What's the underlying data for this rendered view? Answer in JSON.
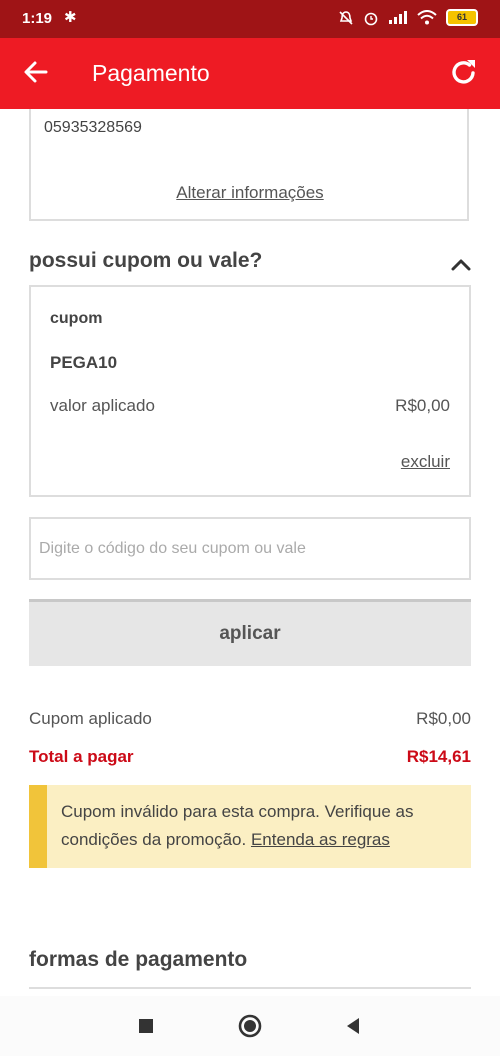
{
  "status_bar": {
    "time": "1:19",
    "battery": "61"
  },
  "app_bar": {
    "title": "Pagamento"
  },
  "customer_info": {
    "phone": "05935328569",
    "edit_link": "Alterar informações"
  },
  "coupon_section": {
    "title": "possui cupom ou vale?",
    "coupon_label": "cupom",
    "coupon_code": "PEGA10",
    "applied_label": "valor aplicado",
    "applied_value": "R$0,00",
    "remove_link": "excluir",
    "input_placeholder": "Digite o código do seu cupom ou vale",
    "apply_button": "aplicar"
  },
  "summary": {
    "coupon_applied_label": "Cupom aplicado",
    "coupon_applied_value": "R$0,00",
    "total_label": "Total a pagar",
    "total_value": "R$14,61"
  },
  "alert": {
    "message": "Cupom inválido para esta compra. Verifique as condições da promoção.",
    "link": "Entenda as regras"
  },
  "payment_section": {
    "title": "formas de pagamento"
  },
  "colors": {
    "brand_red": "#ee1b24",
    "status_bar": "#9f1416",
    "total_red": "#cc0a17",
    "alert_bg": "#fbefc3",
    "alert_accent": "#f1c43a"
  },
  "icons": [
    "bluetooth-icon",
    "mute-icon",
    "alarm-icon",
    "signal-icon",
    "wifi-icon",
    "battery-icon",
    "back-arrow-icon",
    "refresh-icon",
    "chevron-up-icon",
    "stop-square-icon",
    "home-circle-icon",
    "back-triangle-icon"
  ]
}
